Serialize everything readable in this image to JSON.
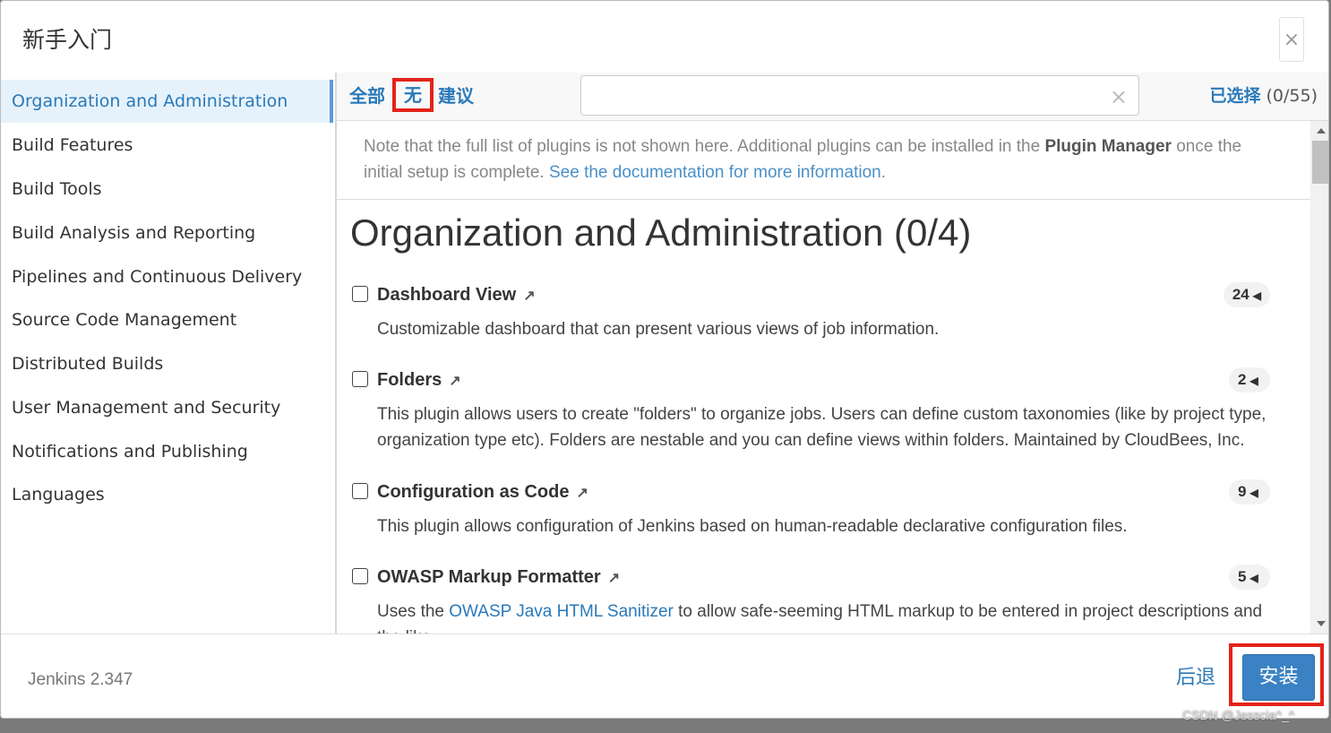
{
  "header": {
    "title": "新手入门",
    "close_glyph": "×"
  },
  "sidebar": {
    "items": [
      {
        "label": "Organization and Administration",
        "active": true
      },
      {
        "label": "Build Features"
      },
      {
        "label": "Build Tools"
      },
      {
        "label": "Build Analysis and Reporting"
      },
      {
        "label": "Pipelines and Continuous Delivery"
      },
      {
        "label": "Source Code Management"
      },
      {
        "label": "Distributed Builds"
      },
      {
        "label": "User Management and Security"
      },
      {
        "label": "Notifications and Publishing"
      },
      {
        "label": "Languages"
      }
    ]
  },
  "toolbar": {
    "filter_all": "全部",
    "filter_none": "无",
    "filter_suggested": "建议",
    "search": {
      "value": "",
      "placeholder": "",
      "clear_glyph": "×"
    },
    "selected_label": "已选择",
    "selected_value": "(0/55)"
  },
  "note": {
    "text_1": "Note that the full list of plugins is not shown here. Additional plugins can be installed in the ",
    "bold": "Plugin Manager",
    "text_2": " once the initial setup is complete. ",
    "link": "See the documentation for more information",
    "text_3": "."
  },
  "section": {
    "title": "Organization and Administration (0/4)"
  },
  "plugins": [
    {
      "name": "Dashboard View",
      "deps": "24",
      "desc": "Customizable dashboard that can present various views of job information."
    },
    {
      "name": "Folders",
      "deps": "2",
      "desc": "This plugin allows users to create \"folders\" to organize jobs. Users can define custom taxonomies (like by project type, organization type etc). Folders are nestable and you can define views within folders. Maintained by CloudBees, Inc."
    },
    {
      "name": "Configuration as Code",
      "deps": "9",
      "desc": "This plugin allows configuration of Jenkins based on human-readable declarative configuration files."
    },
    {
      "name": "OWASP Markup Formatter",
      "deps": "5",
      "desc_prefix": "Uses the ",
      "desc_link": "OWASP Java HTML Sanitizer",
      "desc_suffix": " to allow safe-seeming HTML markup to be entered in project descriptions and the like."
    }
  ],
  "icons": {
    "external": "↗",
    "dep_arrow": "◀"
  },
  "footer": {
    "version": "Jenkins 2.347",
    "back_label": "后退",
    "install_label": "安装"
  },
  "watermark": "CSDN @Jesscia^_^",
  "colors": {
    "accent": "#2a79b9",
    "primary_button": "#3b82c4",
    "highlight": "#e2231a"
  }
}
